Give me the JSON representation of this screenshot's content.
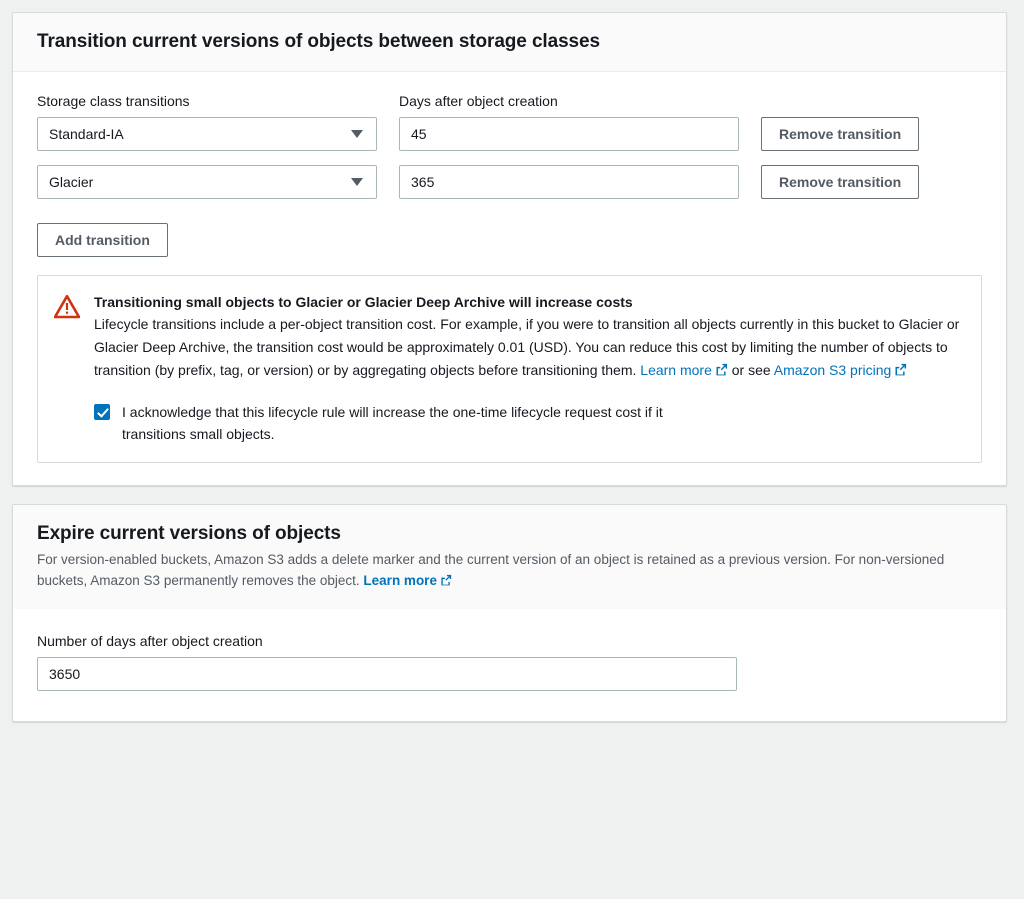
{
  "transition_panel": {
    "title": "Transition current versions of objects between storage classes",
    "labels": {
      "storage_class": "Storage class transitions",
      "days": "Days after object creation"
    },
    "transitions": [
      {
        "storage_class": "Standard-IA",
        "days": "45",
        "remove_label": "Remove transition"
      },
      {
        "storage_class": "Glacier",
        "days": "365",
        "remove_label": "Remove transition"
      }
    ],
    "add_label": "Add transition",
    "alert": {
      "icon": "warning-triangle-icon",
      "title": "Transitioning small objects to Glacier or Glacier Deep Archive will increase costs",
      "text_before_link": "Lifecycle transitions include a per-object transition cost. For example, if you were to transition all objects currently in this bucket to Glacier or Glacier Deep Archive, the transition cost would be approximately 0.01 (USD). You can reduce this cost by limiting the number of objects to transition (by prefix, tag, or version) or by aggregating objects before transitioning them. ",
      "link1": "Learn more",
      "text_middle": " or see ",
      "link2": "Amazon S3 pricing",
      "external_icon": "external-link-icon"
    },
    "acknowledge": {
      "checked": true,
      "text": "I acknowledge that this lifecycle rule will increase the one-time lifecycle request cost if it transitions small objects."
    }
  },
  "expire_panel": {
    "title": "Expire current versions of objects",
    "description_before_link": "For version-enabled buckets, Amazon S3 adds a delete marker and the current version of an object is retained as a previous version. For non-versioned buckets, Amazon S3 permanently removes the object. ",
    "description_link": "Learn more",
    "days_label": "Number of days after object creation",
    "days_value": "3650"
  },
  "colors": {
    "link": "#0073bb",
    "warning": "#d13212",
    "checkbox": "#0073bb",
    "page_bg": "#eff0f0",
    "panel_border": "#d5dbdb"
  }
}
